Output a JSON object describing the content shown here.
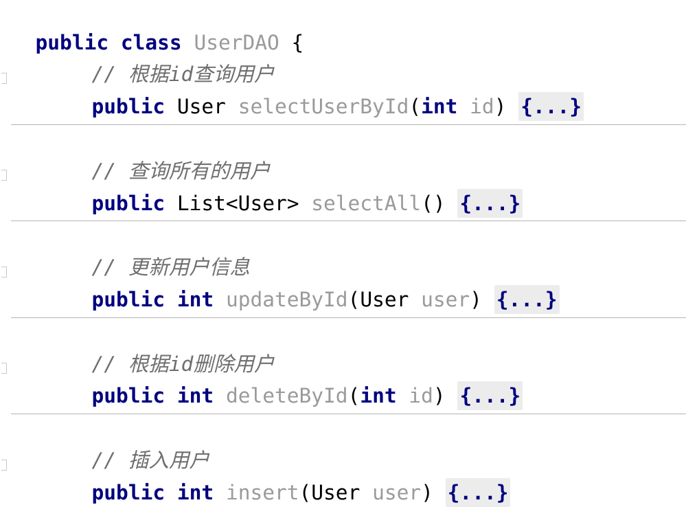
{
  "class_decl": {
    "kw_public": "public",
    "kw_class": "class",
    "name": "UserDAO",
    "brace": "{"
  },
  "methods": [
    {
      "comment": "// 根据id查询用户",
      "kw_public": "public",
      "return_type": "User",
      "return_bold": false,
      "name": "selectUserById",
      "param_open": "(",
      "param_type": "int",
      "param_type_bold": true,
      "param_name": "id",
      "param_close": ")",
      "body": "{...}"
    },
    {
      "comment": "// 查询所有的用户",
      "kw_public": "public",
      "return_type": "List<User>",
      "return_bold": false,
      "name": "selectAll",
      "param_open": "()",
      "param_type": "",
      "param_type_bold": false,
      "param_name": "",
      "param_close": "",
      "body": "{...}"
    },
    {
      "comment": "// 更新用户信息",
      "kw_public": "public",
      "return_type": "int",
      "return_bold": true,
      "name": "updateById",
      "param_open": "(",
      "param_type": "User",
      "param_type_bold": false,
      "param_name": "user",
      "param_close": ")",
      "body": "{...}"
    },
    {
      "comment": "// 根据id删除用户",
      "kw_public": "public",
      "return_type": "int",
      "return_bold": true,
      "name": "deleteById",
      "param_open": "(",
      "param_type": "int",
      "param_type_bold": true,
      "param_name": "id",
      "param_close": ")",
      "body": "{...}"
    },
    {
      "comment": "// 插入用户",
      "kw_public": "public",
      "return_type": "int",
      "return_bold": true,
      "name": "insert",
      "param_open": "(",
      "param_type": "User",
      "param_type_bold": false,
      "param_name": "user",
      "param_close": ")",
      "body": "{...}"
    }
  ],
  "colors": {
    "keyword": "#000080",
    "identifier": "#9a9a9a",
    "comment": "#6f6f6f",
    "fold_background": "#ececec",
    "separator": "#b4b4b4"
  }
}
